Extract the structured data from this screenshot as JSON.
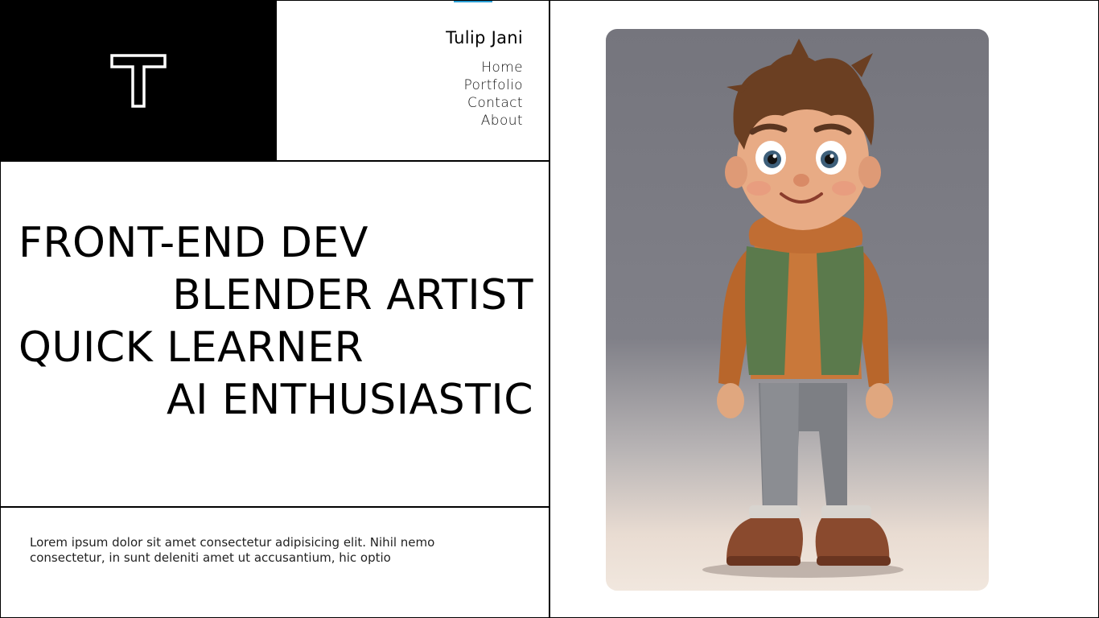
{
  "brand": {
    "logo_letter": "T",
    "name": "Tulip Jani"
  },
  "nav": {
    "items": [
      "Home",
      "Portfolio",
      "Contact",
      "About"
    ]
  },
  "hero": {
    "lines": [
      "FRONT-END DEV",
      "BLENDER ARTIST",
      "QUICK LEARNER",
      "AI ENTHUSIASTIC"
    ]
  },
  "footer": {
    "text": "Lorem ipsum dolor sit amet consectetur adipisicing elit. Nihil nemo consectetur, in sunt deleniti amet ut accusantium, hic optio"
  },
  "colors": {
    "background": "#ffffff",
    "text": "#000000",
    "logo_bg": "#000000",
    "accent": "#2a9fd6"
  },
  "icons": {
    "logo": "t-monogram-icon",
    "portrait": "cartoon-boy-avatar"
  }
}
